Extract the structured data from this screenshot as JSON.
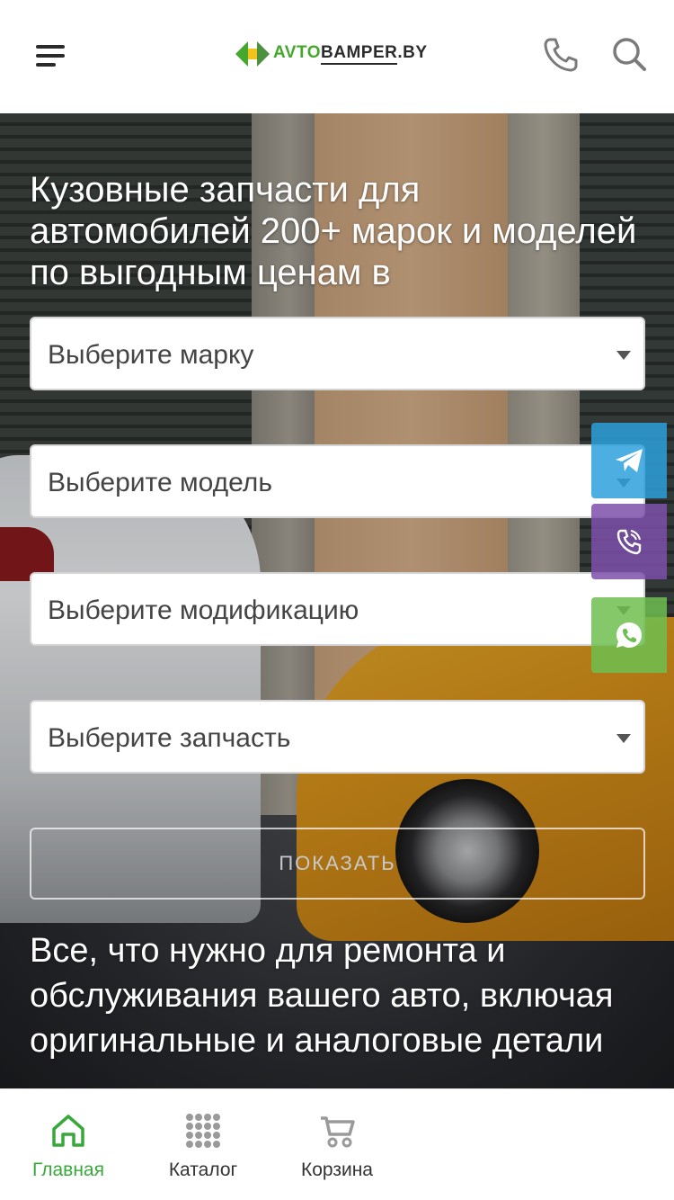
{
  "header": {
    "logo": {
      "part1": "AVTO",
      "part2": "BAMPER",
      "part3": ".BY"
    },
    "icons": {
      "menu": "hamburger-icon",
      "phone": "phone-icon",
      "search": "search-icon"
    },
    "brand_color": "#44a82d"
  },
  "hero": {
    "title": "Кузовные запчасти для автомобилей 200+ марок и моделей по выгодным ценам в",
    "selects": [
      {
        "placeholder": "Выберите марку"
      },
      {
        "placeholder": "Выберите модель"
      },
      {
        "placeholder": "Выберите модификацию"
      },
      {
        "placeholder": "Выберите запчасть"
      }
    ],
    "show_button": "ПОКАЗАТЬ",
    "subtitle": "Все, что нужно для ремонта и обслуживания вашего авто, включая оригинальные и аналоговые детали"
  },
  "messengers": [
    {
      "icon": "telegram-icon",
      "color": "#2da0dc"
    },
    {
      "icon": "viber-icon",
      "color": "#7d50aa"
    },
    {
      "icon": "whatsapp-icon",
      "color": "#6ebe50"
    }
  ],
  "bottom_nav": {
    "items": [
      {
        "label": "Главная",
        "icon": "home-icon",
        "active": true
      },
      {
        "label": "Каталог",
        "icon": "grid-icon",
        "active": false
      },
      {
        "label": "Корзина",
        "icon": "cart-icon",
        "active": false
      }
    ],
    "active_color": "#39a83a"
  }
}
